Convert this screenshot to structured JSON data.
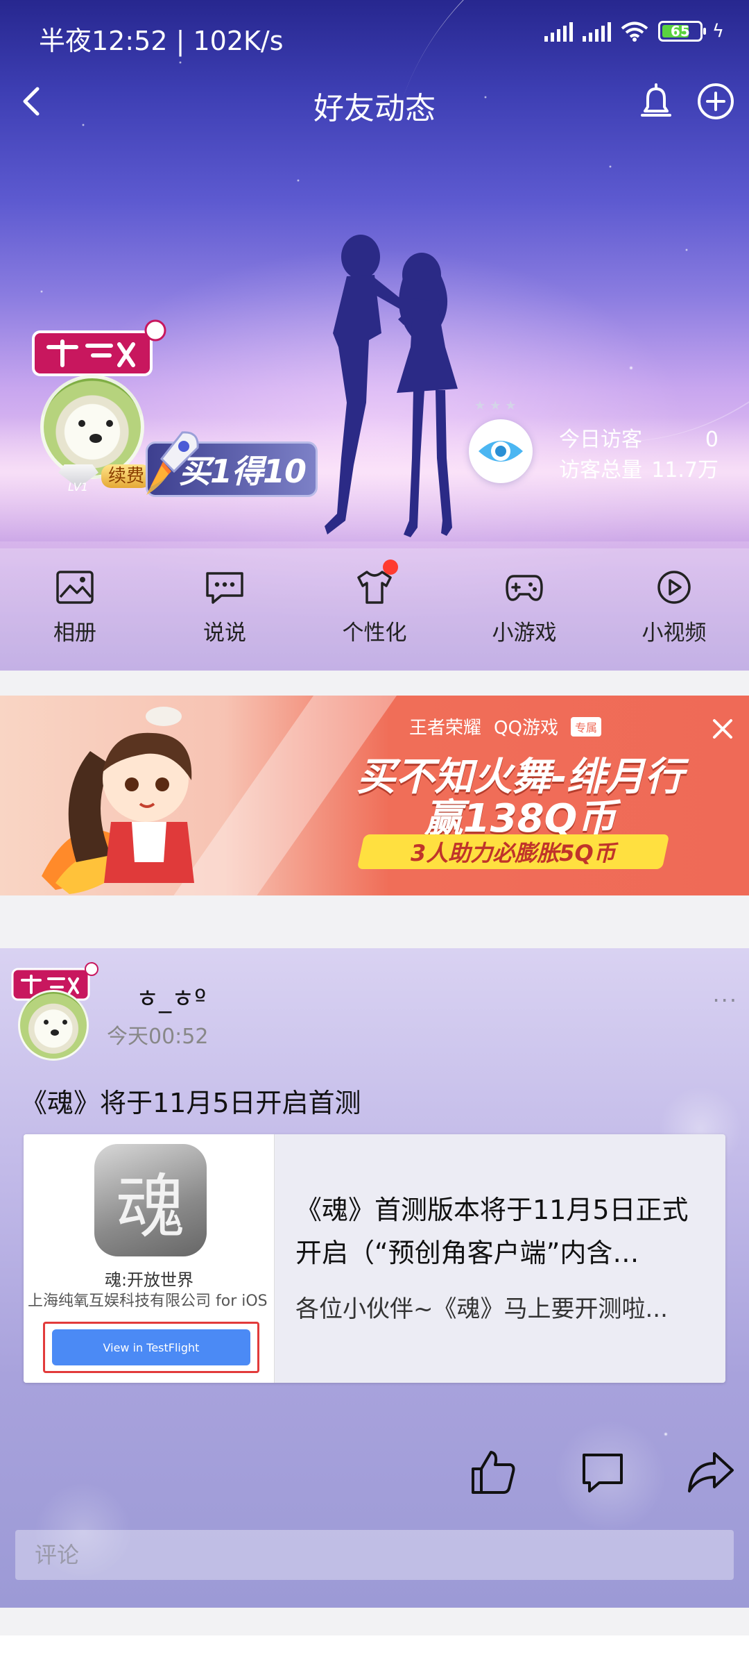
{
  "status_bar": {
    "time": "半夜12:52 | 102K/s",
    "battery": "65"
  },
  "header": {
    "title": "好友动态"
  },
  "profile": {
    "level": "LV1",
    "renew_label": "续费",
    "promo_label": "买1得10"
  },
  "visitors": {
    "today_label": "今日访客",
    "today_value": "0",
    "total_label": "访客总量",
    "total_value": "11.7万"
  },
  "hero_menu": [
    {
      "label": "相册",
      "icon": "album-icon"
    },
    {
      "label": "说说",
      "icon": "message-icon"
    },
    {
      "label": "个性化",
      "icon": "tshirt-icon"
    },
    {
      "label": "小游戏",
      "icon": "gamepad-icon"
    },
    {
      "label": "小视频",
      "icon": "play-icon"
    }
  ],
  "ad": {
    "brand1": "王者荣耀",
    "brand2": "QQ游戏",
    "tag": "专属",
    "headline1": "买不知火舞-绯月行",
    "headline2": "赢138Q币",
    "subline": "3人助力必膨胀5Q币"
  },
  "post": {
    "nickname": "ㅎ_ㅎº",
    "time": "今天00:52",
    "more": "···",
    "content": "《魂》将于11月5日开启首测",
    "card": {
      "app_name": "魂:开放世界",
      "company": "上海纯氧互娱科技有限公司 for iOS",
      "button_label": "View in TestFlight",
      "title": "《魂》首测版本将于11月5日正式开启（“预创角客户端”内含…",
      "description": "各位小伙伴~《魂》马上要开测啦..."
    },
    "comment_placeholder": "评论"
  }
}
